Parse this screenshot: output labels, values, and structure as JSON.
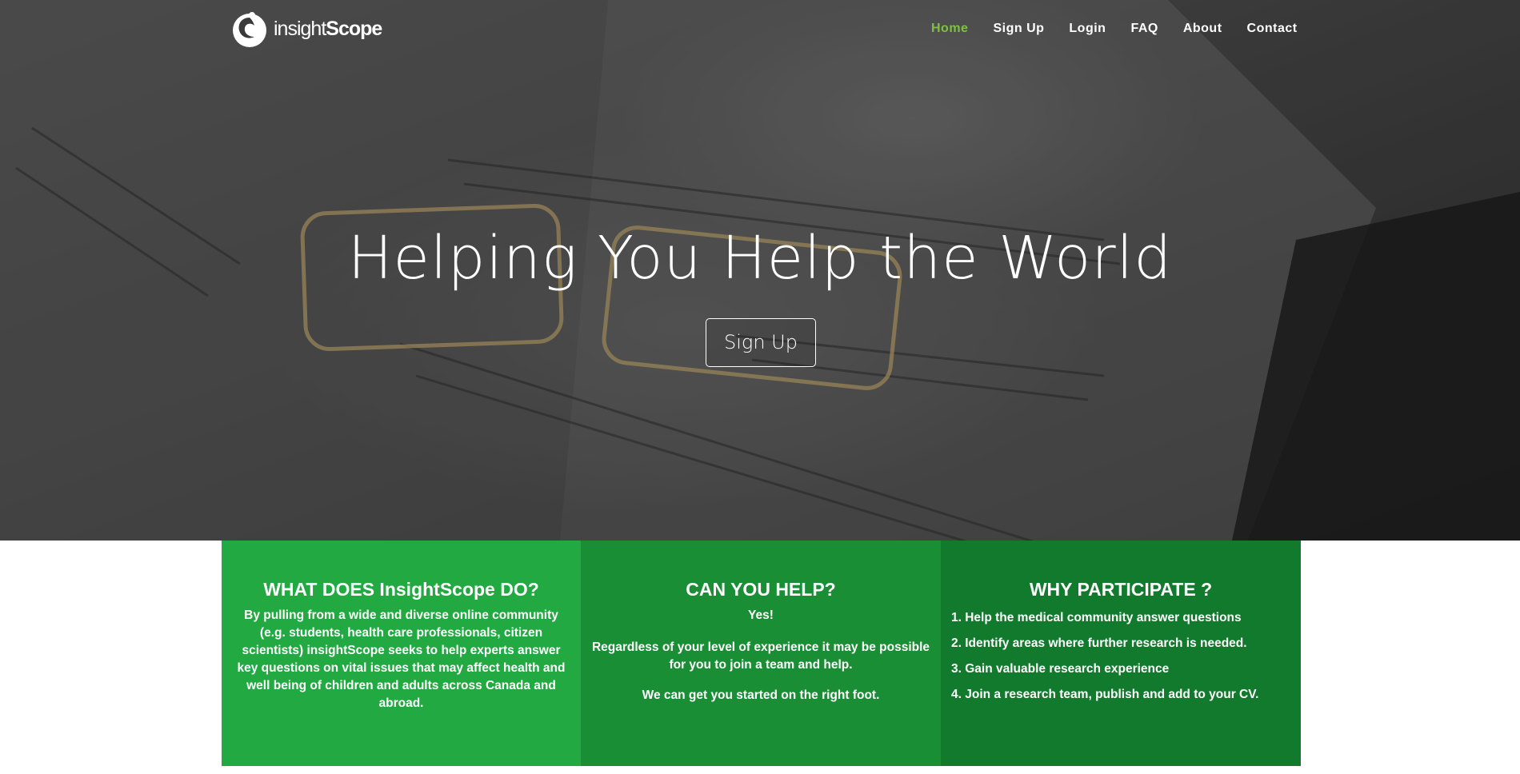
{
  "brand": {
    "logo_regular": "insight",
    "logo_bold": "Scope"
  },
  "nav": {
    "items": [
      "Home",
      "Sign Up",
      "Login",
      "FAQ",
      "About",
      "Contact"
    ],
    "active": "Home",
    "active_color": "#7ec142"
  },
  "hero": {
    "title": "Helping You Help the World",
    "cta_label": "Sign Up"
  },
  "features": {
    "colors": [
      "#22a942",
      "#1a8e35",
      "#127a2d"
    ],
    "what": {
      "title": "WHAT DOES InsightScope DO?",
      "body": "By pulling from a wide and diverse online community (e.g. students, health care professionals, citizen scientists) insightScope seeks to help experts answer key questions on vital issues that may affect health and well being of children and adults across Canada and abroad."
    },
    "help": {
      "title": "CAN YOU HELP?",
      "answer": "Yes!",
      "body": "Regardless of your level of experience it may be possible for you to join a team and help.",
      "closing": "We can get you started on the right foot."
    },
    "why": {
      "title": "WHY PARTICIPATE ?",
      "items": [
        "1. Help the medical community answer questions",
        "2. Identify areas where further research is needed.",
        "3. Gain valuable research experience",
        "4. Join a research team, publish and add to your CV."
      ]
    }
  }
}
